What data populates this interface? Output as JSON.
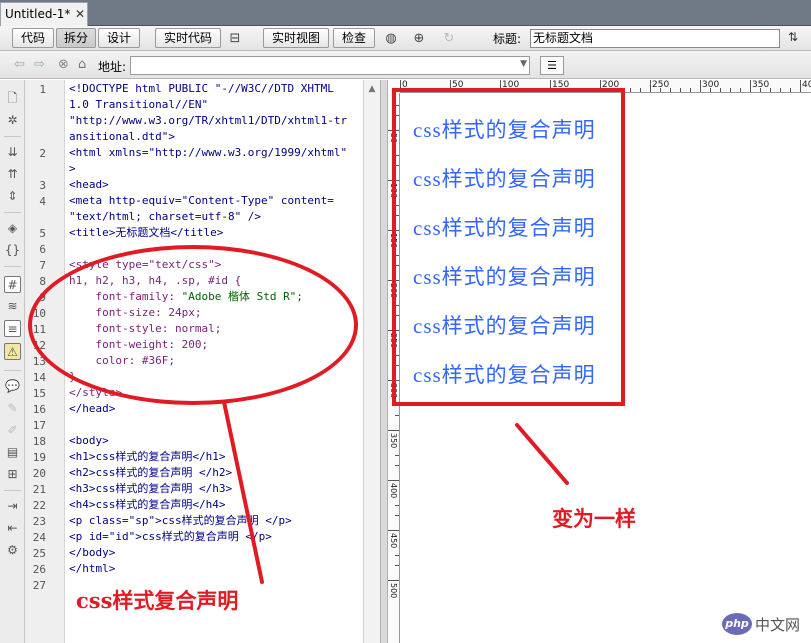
{
  "tab": {
    "title": "Untitled-1*",
    "close": "✕"
  },
  "toolbar": {
    "code": "代码",
    "split": "拆分",
    "design": "设计",
    "live_code": "实时代码",
    "live_view": "实时视图",
    "inspect": "检查",
    "title_label": "标题:",
    "title_value": "无标题文档"
  },
  "address": {
    "label": "地址:",
    "value": ""
  },
  "line_numbers": [
    "1",
    "2",
    "3",
    "4",
    "5",
    "6",
    "7",
    "8",
    "9",
    "10",
    "11",
    "12",
    "13",
    "14",
    "15",
    "16",
    "17",
    "18",
    "19",
    "20",
    "21",
    "22",
    "23",
    "24",
    "25",
    "26",
    "27"
  ],
  "code": {
    "l1a": "<!DOCTYPE html PUBLIC \"-//W3C//DTD XHTML",
    "l1b": "1.0 Transitional//EN\"",
    "l1c": "\"http://www.w3.org/TR/xhtml1/DTD/xhtml1-tr",
    "l1d": "ansitional.dtd\">",
    "l2a": "<html xmlns=\"http://www.w3.org/1999/xhtml\"",
    "l2b": ">",
    "l3": "<head>",
    "l4a": "<meta http-equiv=\"Content-Type\" content=",
    "l4b": "\"text/html; charset=utf-8\" />",
    "l5": "<title>无标题文档</title>",
    "l7": "<style type=\"text/css\">",
    "l8": "h1, h2, h3, h4, .sp, #id {",
    "l9_prop": "    font-family: ",
    "l9_val": "\"Adobe 楷体 Std R\";",
    "l10": "    font-size: 24px;",
    "l11": "    font-style: normal;",
    "l12": "    font-weight: 200;",
    "l13": "    color: #36F;",
    "l14": "}",
    "l15": "</style>",
    "l16": "</head>",
    "l18": "<body>",
    "l19": "<h1>css样式的复合声明</h1>",
    "l20": "<h2>css样式的复合声明 </h2>",
    "l21": "<h3>css样式的复合声明 </h3>",
    "l22": "<h4>css样式的复合声明</h4>",
    "l23": "<p class=\"sp\">css样式的复合声明 </p>",
    "l24": "<p id=\"id\">css样式的复合声明 </p>",
    "l25": "</body>",
    "l26": "</html>"
  },
  "ruler": {
    "top_labels": [
      "0",
      "50",
      "100",
      "150",
      "200",
      "250",
      "300",
      "350",
      "400"
    ],
    "left_labels": [
      "50",
      "100",
      "150",
      "200",
      "250",
      "300",
      "350",
      "400",
      "450",
      "500"
    ]
  },
  "design_view": {
    "lines": [
      "css样式的复合声明",
      "css样式的复合声明",
      "css样式的复合声明",
      "css样式的复合声明",
      "css样式的复合声明",
      "css样式的复合声明"
    ],
    "text_color": "#3366FF"
  },
  "annotations": {
    "left_caption": "css样式复合声明",
    "right_caption": "变为一样",
    "color": "#E01B24"
  },
  "watermark": {
    "logo": "php",
    "text": "中文网"
  }
}
